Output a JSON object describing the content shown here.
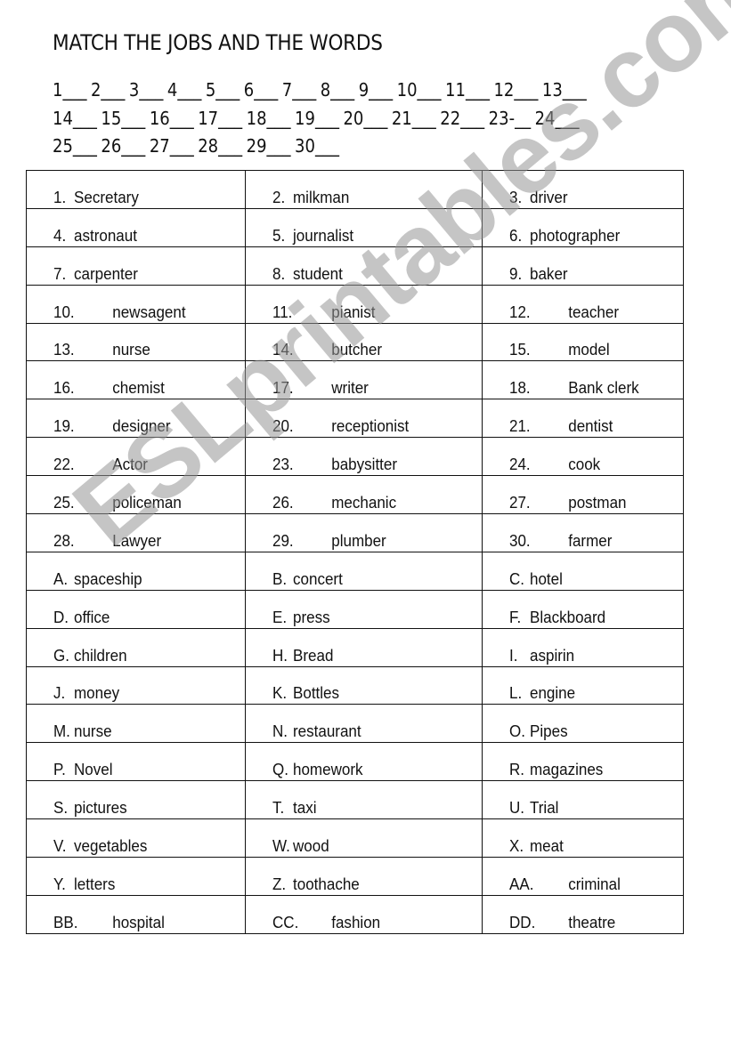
{
  "title": "MATCH THE JOBS AND THE WORDS",
  "answer_lines": [
    [
      "1___",
      "2___",
      "3___",
      "4___",
      "5___",
      "6___",
      "7___",
      "8___",
      "9___",
      "10___",
      "11___",
      "12___",
      "13___"
    ],
    [
      "14___",
      "15___",
      "16___",
      "17___",
      "18___",
      "19___",
      "20___",
      "21___",
      "22___",
      "23-__",
      "24___"
    ],
    [
      "25___",
      "26___",
      "27___",
      "28___",
      "29___",
      "30___"
    ]
  ],
  "jobs": [
    {
      "num": "1.",
      "word": "Secretary",
      "style": "short"
    },
    {
      "num": "2.",
      "word": "milkman",
      "style": "short"
    },
    {
      "num": "3.",
      "word": "driver",
      "style": "short"
    },
    {
      "num": "4.",
      "word": "astronaut",
      "style": "short"
    },
    {
      "num": "5.",
      "word": "journalist",
      "style": "short"
    },
    {
      "num": "6.",
      "word": "photographer",
      "style": "short"
    },
    {
      "num": "7.",
      "word": "carpenter",
      "style": "short"
    },
    {
      "num": "8.",
      "word": "student",
      "style": "short"
    },
    {
      "num": "9.",
      "word": "baker",
      "style": "short"
    },
    {
      "num": "10.",
      "word": "newsagent",
      "style": "tab"
    },
    {
      "num": "11.",
      "word": "pianist",
      "style": "tab"
    },
    {
      "num": "12.",
      "word": "teacher",
      "style": "tab"
    },
    {
      "num": "13.",
      "word": "nurse",
      "style": "tab"
    },
    {
      "num": "14.",
      "word": "butcher",
      "style": "tab"
    },
    {
      "num": "15.",
      "word": "model",
      "style": "tab"
    },
    {
      "num": "16.",
      "word": "chemist",
      "style": "tab"
    },
    {
      "num": "17.",
      "word": "writer",
      "style": "tab"
    },
    {
      "num": "18.",
      "word": "Bank clerk",
      "style": "tab"
    },
    {
      "num": "19.",
      "word": "designer",
      "style": "tab"
    },
    {
      "num": "20.",
      "word": "receptionist",
      "style": "tab"
    },
    {
      "num": "21.",
      "word": "dentist",
      "style": "tab"
    },
    {
      "num": "22.",
      "word": "Actor",
      "style": "tab"
    },
    {
      "num": "23.",
      "word": "babysitter",
      "style": "tab"
    },
    {
      "num": "24.",
      "word": "cook",
      "style": "tab"
    },
    {
      "num": "25.",
      "word": "policeman",
      "style": "tab"
    },
    {
      "num": "26.",
      "word": "mechanic",
      "style": "tab"
    },
    {
      "num": "27.",
      "word": "postman",
      "style": "tab"
    },
    {
      "num": "28.",
      "word": "Lawyer",
      "style": "tab"
    },
    {
      "num": "29.",
      "word": "plumber",
      "style": "tab"
    },
    {
      "num": "30.",
      "word": "farmer",
      "style": "tab"
    }
  ],
  "words": [
    {
      "num": "A.",
      "word": "spaceship",
      "style": "letter"
    },
    {
      "num": "B.",
      "word": "concert",
      "style": "letter"
    },
    {
      "num": "C.",
      "word": "hotel",
      "style": "letter"
    },
    {
      "num": "D.",
      "word": "office",
      "style": "letter"
    },
    {
      "num": "E.",
      "word": "press",
      "style": "letter"
    },
    {
      "num": "F.",
      "word": "Blackboard",
      "style": "letter"
    },
    {
      "num": "G.",
      "word": "children",
      "style": "letter"
    },
    {
      "num": "H.",
      "word": "Bread",
      "style": "letter"
    },
    {
      "num": "I.",
      "word": "aspirin",
      "style": "letter"
    },
    {
      "num": "J.",
      "word": "money",
      "style": "letter"
    },
    {
      "num": "K.",
      "word": "Bottles",
      "style": "letter"
    },
    {
      "num": "L.",
      "word": "engine",
      "style": "letter"
    },
    {
      "num": "M.",
      "word": "nurse",
      "style": "letter"
    },
    {
      "num": "N.",
      "word": "restaurant",
      "style": "letter"
    },
    {
      "num": "O.",
      "word": "Pipes",
      "style": "letter"
    },
    {
      "num": "P.",
      "word": "Novel",
      "style": "letter"
    },
    {
      "num": "Q.",
      "word": "homework",
      "style": "letter"
    },
    {
      "num": "R.",
      "word": "magazines",
      "style": "letter"
    },
    {
      "num": "S.",
      "word": "pictures",
      "style": "letter"
    },
    {
      "num": "T.",
      "word": "taxi",
      "style": "letter"
    },
    {
      "num": "U.",
      "word": "Trial",
      "style": "letter"
    },
    {
      "num": "V.",
      "word": "vegetables",
      "style": "letter"
    },
    {
      "num": "W.",
      "word": "wood",
      "style": "letter"
    },
    {
      "num": "X.",
      "word": "meat",
      "style": "letter"
    },
    {
      "num": "Y.",
      "word": "letters",
      "style": "letter"
    },
    {
      "num": "Z.",
      "word": "toothache",
      "style": "letter"
    },
    {
      "num": "AA.",
      "word": "criminal",
      "style": "tab"
    },
    {
      "num": "BB.",
      "word": "hospital",
      "style": "tab"
    },
    {
      "num": "CC.",
      "word": "fashion",
      "style": "tab"
    },
    {
      "num": "DD.",
      "word": "theatre",
      "style": "tab"
    }
  ],
  "watermark": "ESLprintables.com",
  "colors": {
    "text": "#111111",
    "border": "#111111",
    "watermark": "#969696"
  }
}
